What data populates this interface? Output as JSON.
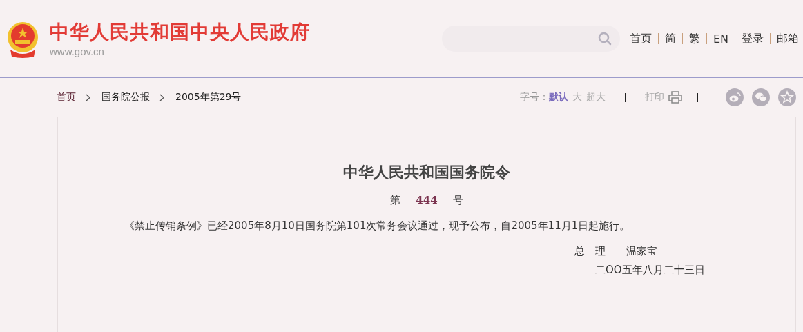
{
  "header": {
    "site_title": "中华人民共和国中央人民政府",
    "site_url": "www.gov.cn",
    "nav_links": [
      "首页",
      "简",
      "繁",
      "EN",
      "登录",
      "邮箱"
    ]
  },
  "breadcrumb": [
    "首页",
    "国务院公报",
    "2005年第29号"
  ],
  "toolbar": {
    "font_size_label": "字号：",
    "font_sizes": [
      {
        "label": "默认",
        "selected": true
      },
      {
        "label": "大",
        "selected": false
      },
      {
        "label": "超大",
        "selected": false
      }
    ],
    "print_label": "打印"
  },
  "article": {
    "title": "中华人民共和国国务院令",
    "order_prefix": "第",
    "order_number": "444",
    "order_suffix": "号",
    "body": "《禁止传销条例》已经2005年8月10日国务院第101次常务会议通过，现予公布，自2005年11月1日起施行。",
    "signer_title": "总　理",
    "signer_name": "温家宝",
    "date": "二OO五年八月二十三日"
  }
}
